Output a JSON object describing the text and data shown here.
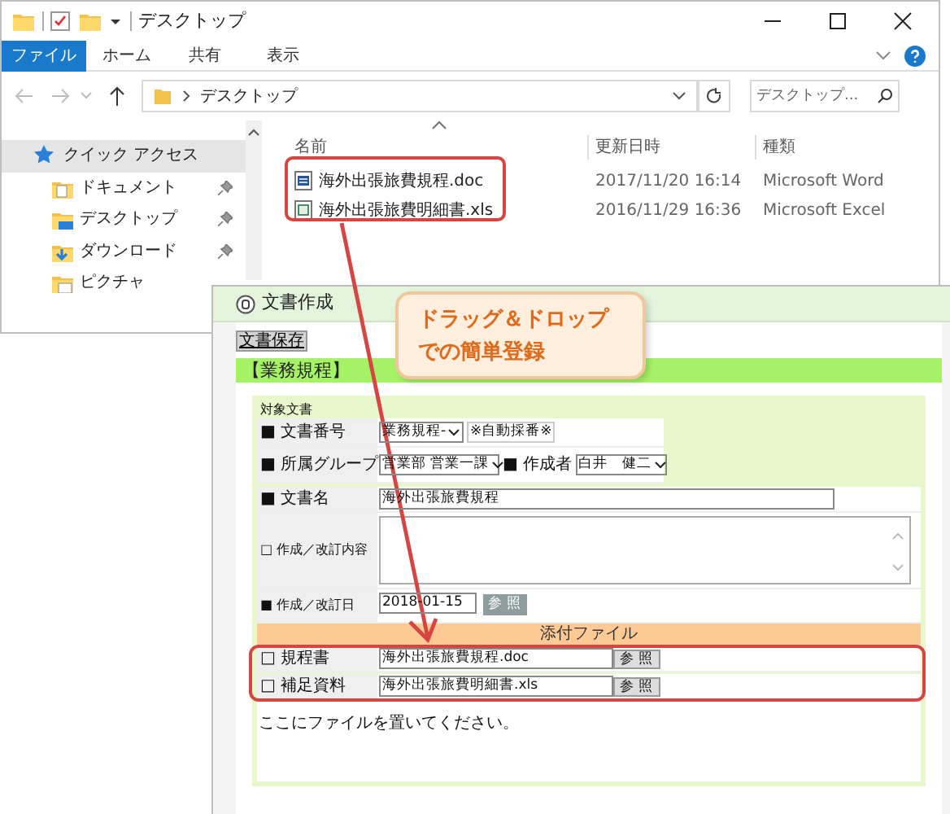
{
  "explorer": {
    "title": "デスクトップ",
    "tabs": [
      {
        "label": "ファイル",
        "selected": true
      },
      {
        "label": "ホーム",
        "selected": false
      },
      {
        "label": "共有",
        "selected": false
      },
      {
        "label": "表示",
        "selected": false
      }
    ],
    "address": "デスクトップ",
    "search": {
      "placeholder": "デスクトップ..."
    },
    "sidebar": [
      {
        "label": "クイック アクセス",
        "kind": "star",
        "selected": true,
        "pinned": false
      },
      {
        "label": "ドキュメント",
        "kind": "docs",
        "selected": false,
        "pinned": true
      },
      {
        "label": "デスクトップ",
        "kind": "desktop",
        "selected": false,
        "pinned": true
      },
      {
        "label": "ダウンロード",
        "kind": "download",
        "selected": false,
        "pinned": true
      },
      {
        "label": "ピクチャ",
        "kind": "pictures",
        "selected": false,
        "pinned": false
      }
    ],
    "columns": [
      "名前",
      "更新日時",
      "種類"
    ],
    "files": [
      {
        "name": "海外出張旅費規程.doc",
        "kind": "doc",
        "date": "2017/11/20 16:14",
        "type": "Microsoft Word"
      },
      {
        "name": "海外出張旅費明細書.xls",
        "kind": "xls",
        "date": "2016/11/29 16:36",
        "type": "Microsoft Excel"
      }
    ]
  },
  "app": {
    "title": "文書作成",
    "save_button": "文書保存",
    "section_title": "【業務規程】",
    "group_label": "対象文書",
    "rows": [
      {
        "kind": "select",
        "label": "■ 文書番号",
        "value": "業務規程-",
        "note": "※自動採番※"
      },
      {
        "kind": "group",
        "label": "■ 所属グループ",
        "value": "営業部 営業一課",
        "label_2": "■ 作成者",
        "value_2": "白井　健二"
      },
      {
        "kind": "text",
        "label": "■ 文書名",
        "value": "海外出張旅費規程"
      },
      {
        "kind": "textarea",
        "label": "□ 作成／改訂内容"
      },
      {
        "kind": "date",
        "label": "■ 作成／改訂日",
        "value": "2018-01-15",
        "button": "参 照"
      }
    ],
    "attachments_header": "添付ファイル",
    "attachments": [
      {
        "label": "□ 規程書",
        "value": "海外出張旅費規程.doc",
        "button": "参 照"
      },
      {
        "label": "□ 補足資料",
        "value": "海外出張旅費明細書.xls",
        "button": "参 照"
      }
    ],
    "drop_hint": "ここにファイルを置いてください。"
  },
  "callout": [
    "ドラッグ＆ドロップ",
    "での簡単登録"
  ]
}
